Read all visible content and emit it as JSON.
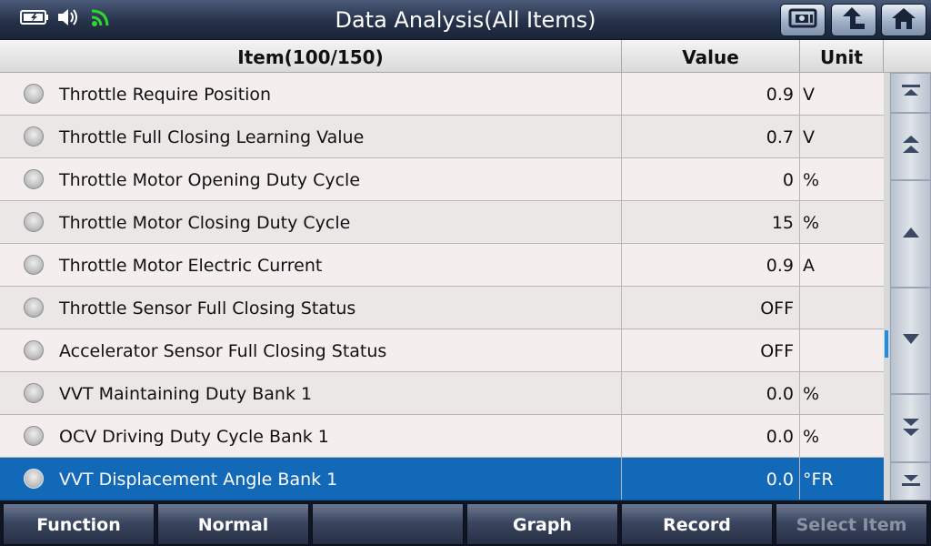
{
  "header": {
    "title": "Data Analysis(All Items)",
    "status_icons": [
      "battery-icon",
      "speaker-icon",
      "wifi-icon"
    ],
    "buttons": [
      "photo-card-icon",
      "back-up-icon",
      "home-icon"
    ]
  },
  "table": {
    "columns": [
      "Item(100/150)",
      "Value",
      "Unit"
    ],
    "rows": [
      {
        "name": "Throttle Require Position",
        "value": "0.9",
        "unit": "V"
      },
      {
        "name": "Throttle Full Closing Learning Value",
        "value": "0.7",
        "unit": "V"
      },
      {
        "name": "Throttle Motor Opening Duty Cycle",
        "value": "0",
        "unit": "%"
      },
      {
        "name": "Throttle Motor Closing Duty Cycle",
        "value": "15",
        "unit": "%"
      },
      {
        "name": "Throttle Motor Electric Current",
        "value": "0.9",
        "unit": "A"
      },
      {
        "name": "Throttle Sensor Full Closing Status",
        "value": "OFF",
        "unit": ""
      },
      {
        "name": "Accelerator Sensor Full Closing Status",
        "value": "OFF",
        "unit": ""
      },
      {
        "name": "VVT Maintaining Duty Bank 1",
        "value": "0.0",
        "unit": "%"
      },
      {
        "name": "OCV Driving Duty Cycle Bank 1",
        "value": "0.0",
        "unit": "%"
      },
      {
        "name": "VVT Displacement Angle Bank 1",
        "value": "0.0",
        "unit": "°FR",
        "selected": true
      }
    ]
  },
  "scroll": {
    "buttons": [
      "scroll-top-icon",
      "page-up-icon",
      "scroll-up-icon",
      "scroll-down-icon",
      "page-down-icon",
      "scroll-bottom-icon"
    ]
  },
  "bottom_bar": {
    "buttons": [
      {
        "label": "Function",
        "enabled": true
      },
      {
        "label": "Normal",
        "enabled": true
      },
      {
        "label": "",
        "enabled": true
      },
      {
        "label": "Graph",
        "enabled": true
      },
      {
        "label": "Record",
        "enabled": true
      },
      {
        "label": "Select Item",
        "enabled": false
      }
    ]
  },
  "colors": {
    "selected_row": "#1269b8",
    "title_bar": "#26324a",
    "wifi": "#2fd62f"
  }
}
